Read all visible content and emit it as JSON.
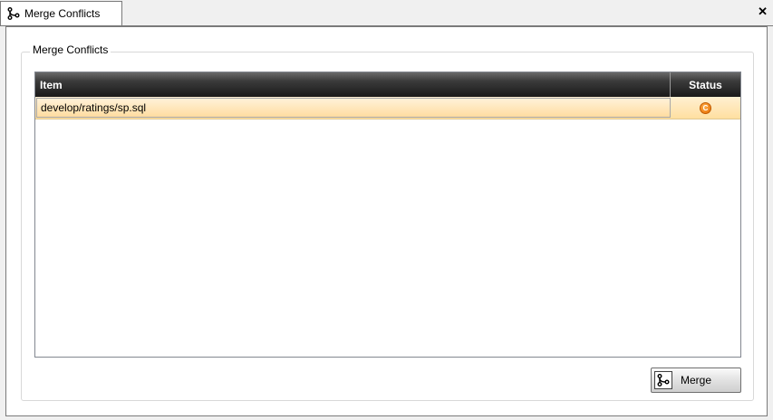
{
  "tab": {
    "title": "Merge Conflicts",
    "icon": "branch-merge-icon",
    "close_label": "✕"
  },
  "group": {
    "title": "Merge Conflicts"
  },
  "grid": {
    "columns": [
      "Item",
      "Status"
    ],
    "rows": [
      {
        "item": "develop/ratings/sp.sql",
        "status": "C",
        "status_icon": "conflict-status-icon",
        "selected": true
      }
    ]
  },
  "merge_button": {
    "label": "Merge",
    "icon": "branch-merge-icon"
  },
  "colors": {
    "selection": "#ffdfa0",
    "header": "#1a1a1a",
    "status_badge": "#f58a07"
  }
}
